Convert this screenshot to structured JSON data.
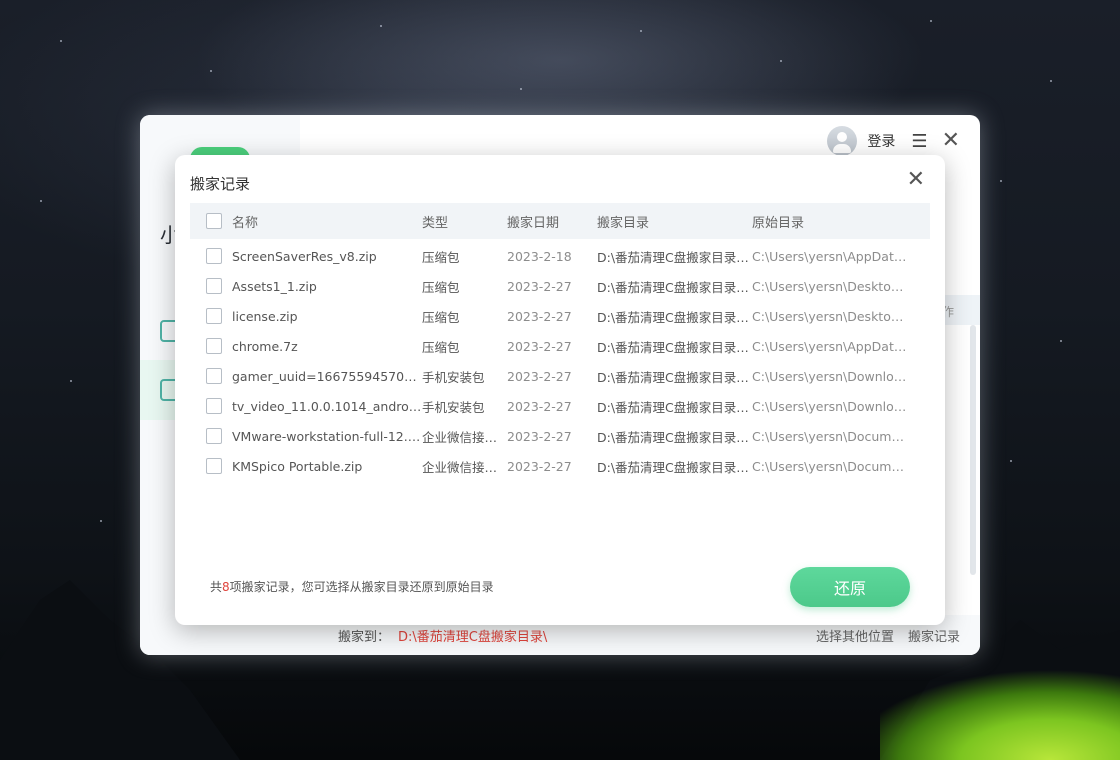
{
  "app": {
    "side_title": "小",
    "login_label": "登录",
    "menu_icon": "menu-icon",
    "close_icon": "close-icon",
    "side_strip_text": "作",
    "footer": {
      "move_to_label": "搬家到：",
      "move_to_path": "D:\\番茄清理C盘搬家目录\\",
      "choose_other_label": "选择其他位置",
      "history_label": "搬家记录"
    }
  },
  "dialog": {
    "title": "搬家记录",
    "columns": {
      "name": "名称",
      "type": "类型",
      "date": "搬家日期",
      "target_dir": "搬家目录",
      "original_dir": "原始目录"
    },
    "rows": [
      {
        "name": "ScreenSaverRes_v8.zip",
        "type": "压缩包",
        "date": "2023-2-18",
        "target_dir": "D:\\番茄清理C盘搬家目录\\...",
        "original_dir": "C:\\Users\\yersn\\AppData\\..."
      },
      {
        "name": "Assets1_1.zip",
        "type": "压缩包",
        "date": "2023-2-27",
        "target_dir": "D:\\番茄清理C盘搬家目录\\...",
        "original_dir": "C:\\Users\\yersn\\Desktop\\..."
      },
      {
        "name": "license.zip",
        "type": "压缩包",
        "date": "2023-2-27",
        "target_dir": "D:\\番茄清理C盘搬家目录\\...",
        "original_dir": "C:\\Users\\yersn\\Desktop\\l..."
      },
      {
        "name": "chrome.7z",
        "type": "压缩包",
        "date": "2023-2-27",
        "target_dir": "D:\\番茄清理C盘搬家目录\\...",
        "original_dir": "C:\\Users\\yersn\\AppData\\..."
      },
      {
        "name": "gamer_uuid=1667559457084_...",
        "type": "手机安装包",
        "date": "2023-2-27",
        "target_dir": "D:\\番茄清理C盘搬家目录\\...",
        "original_dir": "C:\\Users\\yersn\\Downloa..."
      },
      {
        "name": "tv_video_11.0.0.1014_android_...",
        "type": "手机安装包",
        "date": "2023-2-27",
        "target_dir": "D:\\番茄清理C盘搬家目录\\...",
        "original_dir": "C:\\Users\\yersn\\Downloa..."
      },
      {
        "name": "VMware-workstation-full-12.1...",
        "type": "企业微信接收...",
        "date": "2023-2-27",
        "target_dir": "D:\\番茄清理C盘搬家目录\\...",
        "original_dir": "C:\\Users\\yersn\\Documen..."
      },
      {
        "name": "KMSpico Portable.zip",
        "type": "企业微信接收...",
        "date": "2023-2-27",
        "target_dir": "D:\\番茄清理C盘搬家目录\\...",
        "original_dir": "C:\\Users\\yersn\\Documen..."
      }
    ],
    "summary_prefix": "共",
    "summary_count": "8",
    "summary_suffix": "项搬家记录，您可选择从搬家目录还原到原始目录",
    "restore_label": "还原"
  },
  "colors": {
    "accent_green": "#4cc98a",
    "highlight_red": "#e0443c"
  }
}
